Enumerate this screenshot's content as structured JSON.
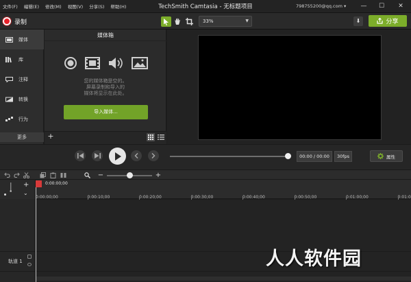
{
  "window": {
    "title": "TechSmith Camtasia - 无标题项目",
    "menu": [
      "文件(F)",
      "编辑(E)",
      "修改(M)",
      "视图(V)",
      "分享(S)",
      "帮助(H)"
    ],
    "account": "798755200@qq.com",
    "controls": [
      "—",
      "☐",
      "✕"
    ]
  },
  "toolbar": {
    "record_label": "录制",
    "zoom": "33%",
    "share_label": "分享"
  },
  "rail": {
    "items": [
      "媒体",
      "库",
      "注释",
      "转换",
      "行为"
    ],
    "more_label": "更多"
  },
  "media_bin": {
    "title": "媒体箱",
    "empty_message": [
      "您的媒体箱是空的。",
      "屏幕录制和导入的",
      "媒体将显示在此处。"
    ],
    "import_label": "导入媒体..."
  },
  "playback": {
    "timecode": "00:00 / 00:00",
    "fps": "30fps",
    "properties_label": "属性",
    "scrub_progress": 1.0
  },
  "timeline": {
    "playhead_time": "0:00:00;00",
    "ticks": [
      "0:00:00;00",
      "0:00:10;00",
      "0:00:20;00",
      "0:00:30;00",
      "0:00:40;00",
      "0:00:50;00",
      "0:01:00;00",
      "0:01:0"
    ],
    "track_label": "轨道 1"
  },
  "watermark": "人人软件园",
  "colors": {
    "accent_green": "#7cad2a",
    "record_red": "#e8202a",
    "background": "#1e1e1e"
  }
}
